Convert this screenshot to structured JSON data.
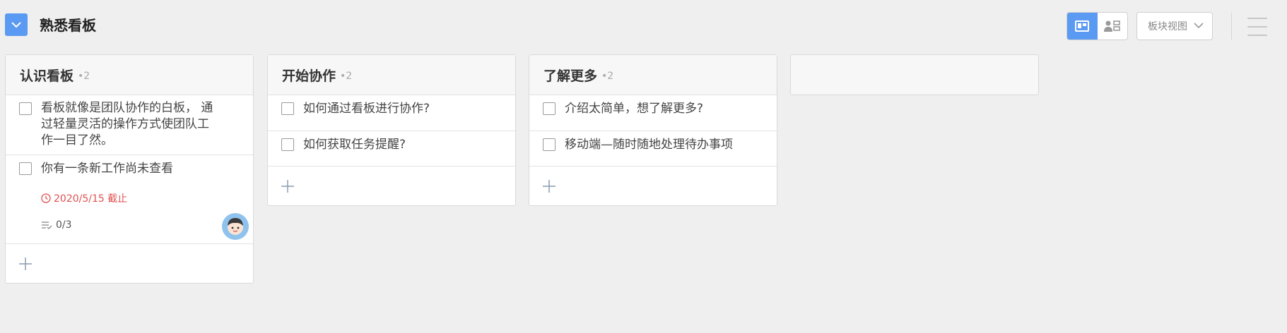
{
  "header": {
    "title": "熟悉看板",
    "view_select_label": "板块视图"
  },
  "columns": [
    {
      "title": "认识看板",
      "count": "•2",
      "cards": [
        {
          "text": "看板就像是团队协作的白板， 通过轻量灵活的操作方式使团队工作一目了然。"
        },
        {
          "text": "你有一条新工作尚未查看",
          "due": "2020/5/15 截止",
          "subtasks": "0/3"
        }
      ]
    },
    {
      "title": "开始协作",
      "count": "•2",
      "cards": [
        {
          "text": "如何通过看板进行协作?"
        },
        {
          "text": "如何获取任务提醒?"
        }
      ]
    },
    {
      "title": "了解更多",
      "count": "•2",
      "cards": [
        {
          "text": "介绍太简单，想了解更多?"
        },
        {
          "text": "移动端—随时随地处理待办事项"
        }
      ]
    }
  ],
  "colors": {
    "accent": "#5b9af2",
    "due": "#e05050",
    "background": "#efefef"
  },
  "icons": [
    "chevron-down-icon",
    "board-view-icon",
    "member-view-icon",
    "hamburger-icon",
    "clock-icon",
    "checklist-icon",
    "plus-icon",
    "avatar"
  ]
}
